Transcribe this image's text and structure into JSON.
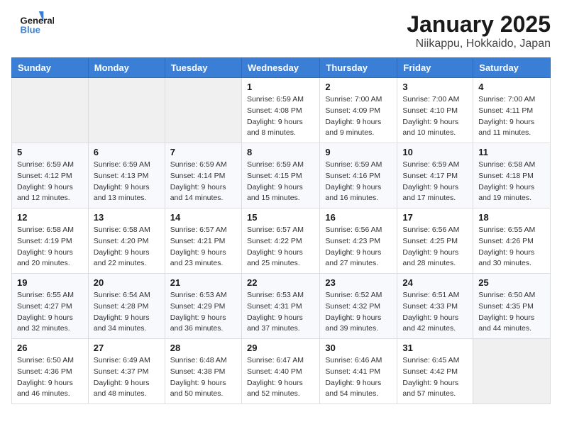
{
  "logo": {
    "line1": "General",
    "line2": "Blue"
  },
  "title": "January 2025",
  "location": "Niikappu, Hokkaido, Japan",
  "weekdays": [
    "Sunday",
    "Monday",
    "Tuesday",
    "Wednesday",
    "Thursday",
    "Friday",
    "Saturday"
  ],
  "weeks": [
    [
      {
        "day": "",
        "sunrise": "",
        "sunset": "",
        "daylight": ""
      },
      {
        "day": "",
        "sunrise": "",
        "sunset": "",
        "daylight": ""
      },
      {
        "day": "",
        "sunrise": "",
        "sunset": "",
        "daylight": ""
      },
      {
        "day": "1",
        "sunrise": "Sunrise: 6:59 AM",
        "sunset": "Sunset: 4:08 PM",
        "daylight": "Daylight: 9 hours and 8 minutes."
      },
      {
        "day": "2",
        "sunrise": "Sunrise: 7:00 AM",
        "sunset": "Sunset: 4:09 PM",
        "daylight": "Daylight: 9 hours and 9 minutes."
      },
      {
        "day": "3",
        "sunrise": "Sunrise: 7:00 AM",
        "sunset": "Sunset: 4:10 PM",
        "daylight": "Daylight: 9 hours and 10 minutes."
      },
      {
        "day": "4",
        "sunrise": "Sunrise: 7:00 AM",
        "sunset": "Sunset: 4:11 PM",
        "daylight": "Daylight: 9 hours and 11 minutes."
      }
    ],
    [
      {
        "day": "5",
        "sunrise": "Sunrise: 6:59 AM",
        "sunset": "Sunset: 4:12 PM",
        "daylight": "Daylight: 9 hours and 12 minutes."
      },
      {
        "day": "6",
        "sunrise": "Sunrise: 6:59 AM",
        "sunset": "Sunset: 4:13 PM",
        "daylight": "Daylight: 9 hours and 13 minutes."
      },
      {
        "day": "7",
        "sunrise": "Sunrise: 6:59 AM",
        "sunset": "Sunset: 4:14 PM",
        "daylight": "Daylight: 9 hours and 14 minutes."
      },
      {
        "day": "8",
        "sunrise": "Sunrise: 6:59 AM",
        "sunset": "Sunset: 4:15 PM",
        "daylight": "Daylight: 9 hours and 15 minutes."
      },
      {
        "day": "9",
        "sunrise": "Sunrise: 6:59 AM",
        "sunset": "Sunset: 4:16 PM",
        "daylight": "Daylight: 9 hours and 16 minutes."
      },
      {
        "day": "10",
        "sunrise": "Sunrise: 6:59 AM",
        "sunset": "Sunset: 4:17 PM",
        "daylight": "Daylight: 9 hours and 17 minutes."
      },
      {
        "day": "11",
        "sunrise": "Sunrise: 6:58 AM",
        "sunset": "Sunset: 4:18 PM",
        "daylight": "Daylight: 9 hours and 19 minutes."
      }
    ],
    [
      {
        "day": "12",
        "sunrise": "Sunrise: 6:58 AM",
        "sunset": "Sunset: 4:19 PM",
        "daylight": "Daylight: 9 hours and 20 minutes."
      },
      {
        "day": "13",
        "sunrise": "Sunrise: 6:58 AM",
        "sunset": "Sunset: 4:20 PM",
        "daylight": "Daylight: 9 hours and 22 minutes."
      },
      {
        "day": "14",
        "sunrise": "Sunrise: 6:57 AM",
        "sunset": "Sunset: 4:21 PM",
        "daylight": "Daylight: 9 hours and 23 minutes."
      },
      {
        "day": "15",
        "sunrise": "Sunrise: 6:57 AM",
        "sunset": "Sunset: 4:22 PM",
        "daylight": "Daylight: 9 hours and 25 minutes."
      },
      {
        "day": "16",
        "sunrise": "Sunrise: 6:56 AM",
        "sunset": "Sunset: 4:23 PM",
        "daylight": "Daylight: 9 hours and 27 minutes."
      },
      {
        "day": "17",
        "sunrise": "Sunrise: 6:56 AM",
        "sunset": "Sunset: 4:25 PM",
        "daylight": "Daylight: 9 hours and 28 minutes."
      },
      {
        "day": "18",
        "sunrise": "Sunrise: 6:55 AM",
        "sunset": "Sunset: 4:26 PM",
        "daylight": "Daylight: 9 hours and 30 minutes."
      }
    ],
    [
      {
        "day": "19",
        "sunrise": "Sunrise: 6:55 AM",
        "sunset": "Sunset: 4:27 PM",
        "daylight": "Daylight: 9 hours and 32 minutes."
      },
      {
        "day": "20",
        "sunrise": "Sunrise: 6:54 AM",
        "sunset": "Sunset: 4:28 PM",
        "daylight": "Daylight: 9 hours and 34 minutes."
      },
      {
        "day": "21",
        "sunrise": "Sunrise: 6:53 AM",
        "sunset": "Sunset: 4:29 PM",
        "daylight": "Daylight: 9 hours and 36 minutes."
      },
      {
        "day": "22",
        "sunrise": "Sunrise: 6:53 AM",
        "sunset": "Sunset: 4:31 PM",
        "daylight": "Daylight: 9 hours and 37 minutes."
      },
      {
        "day": "23",
        "sunrise": "Sunrise: 6:52 AM",
        "sunset": "Sunset: 4:32 PM",
        "daylight": "Daylight: 9 hours and 39 minutes."
      },
      {
        "day": "24",
        "sunrise": "Sunrise: 6:51 AM",
        "sunset": "Sunset: 4:33 PM",
        "daylight": "Daylight: 9 hours and 42 minutes."
      },
      {
        "day": "25",
        "sunrise": "Sunrise: 6:50 AM",
        "sunset": "Sunset: 4:35 PM",
        "daylight": "Daylight: 9 hours and 44 minutes."
      }
    ],
    [
      {
        "day": "26",
        "sunrise": "Sunrise: 6:50 AM",
        "sunset": "Sunset: 4:36 PM",
        "daylight": "Daylight: 9 hours and 46 minutes."
      },
      {
        "day": "27",
        "sunrise": "Sunrise: 6:49 AM",
        "sunset": "Sunset: 4:37 PM",
        "daylight": "Daylight: 9 hours and 48 minutes."
      },
      {
        "day": "28",
        "sunrise": "Sunrise: 6:48 AM",
        "sunset": "Sunset: 4:38 PM",
        "daylight": "Daylight: 9 hours and 50 minutes."
      },
      {
        "day": "29",
        "sunrise": "Sunrise: 6:47 AM",
        "sunset": "Sunset: 4:40 PM",
        "daylight": "Daylight: 9 hours and 52 minutes."
      },
      {
        "day": "30",
        "sunrise": "Sunrise: 6:46 AM",
        "sunset": "Sunset: 4:41 PM",
        "daylight": "Daylight: 9 hours and 54 minutes."
      },
      {
        "day": "31",
        "sunrise": "Sunrise: 6:45 AM",
        "sunset": "Sunset: 4:42 PM",
        "daylight": "Daylight: 9 hours and 57 minutes."
      },
      {
        "day": "",
        "sunrise": "",
        "sunset": "",
        "daylight": ""
      }
    ]
  ]
}
